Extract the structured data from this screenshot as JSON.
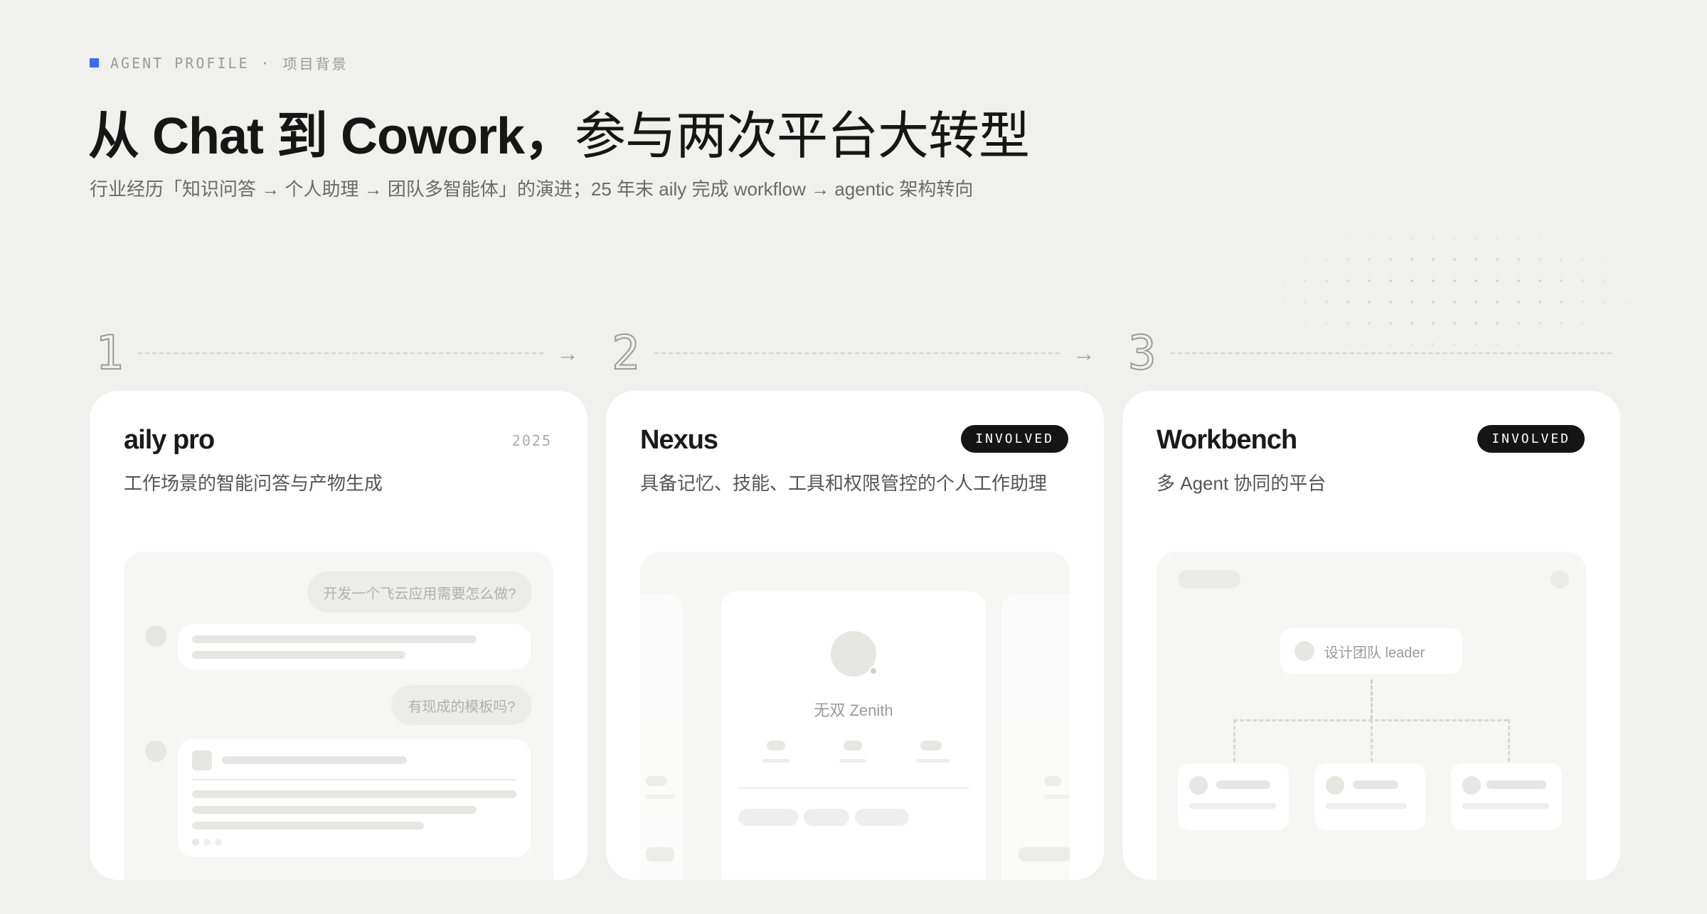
{
  "eyebrow": {
    "label": "AGENT PROFILE",
    "separator": "·",
    "section": "项目背景"
  },
  "title": {
    "bold": "从 Chat 到 Cowork，",
    "thin": "参与两次平台大转型"
  },
  "subtitle": "行业经历「知识问答 → 个人助理 → 团队多智能体」的演进；25 年末 aily 完成 workflow → agentic 架构转向",
  "steps": [
    {
      "num": "1",
      "arrow": "→"
    },
    {
      "num": "2",
      "arrow": "→"
    },
    {
      "num": "3"
    }
  ],
  "cards": [
    {
      "title": "aily pro",
      "desc": "工作场景的智能问答与产物生成",
      "meta": "2025",
      "preview": {
        "q1": "开发一个飞云应用需要怎么做?",
        "q2": "有现成的模板吗?"
      }
    },
    {
      "title": "Nexus",
      "desc": "具备记忆、技能、工具和权限管控的个人工作助理",
      "badge": "INVOLVED",
      "preview": {
        "name": "无双 Zenith"
      }
    },
    {
      "title": "Workbench",
      "desc": "多 Agent 协同的平台",
      "badge": "INVOLVED",
      "preview": {
        "leader": "设计团队 leader"
      }
    }
  ],
  "colors": {
    "accent": "#3b6cf6",
    "background": "#f0f0ee",
    "badge": "#151515"
  }
}
